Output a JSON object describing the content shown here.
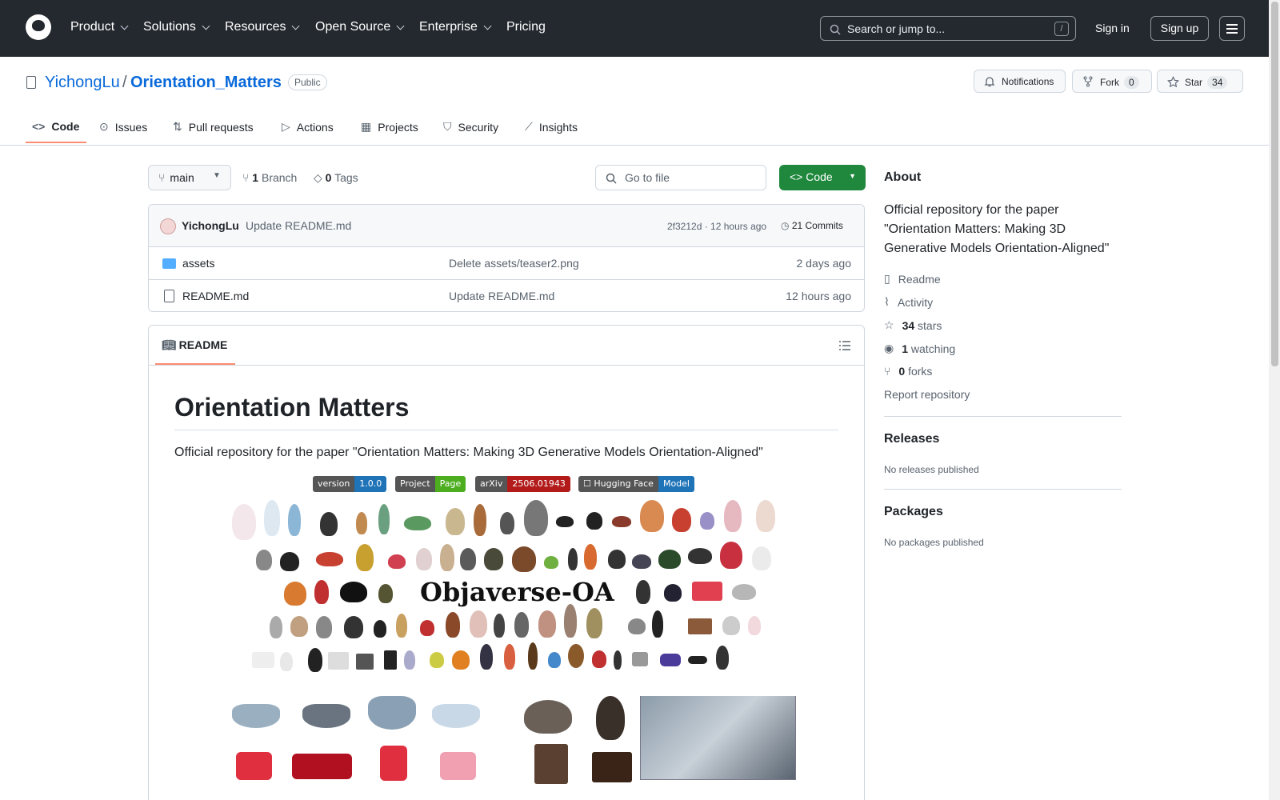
{
  "header": {
    "nav": [
      "Product",
      "Solutions",
      "Resources",
      "Open Source",
      "Enterprise",
      "Pricing"
    ],
    "search_placeholder": "Search or jump to...",
    "search_key": "/",
    "sign_in": "Sign in",
    "sign_up": "Sign up"
  },
  "repo": {
    "owner": "YichongLu",
    "separator": "/",
    "name": "Orientation_Matters",
    "visibility": "Public",
    "notifications": "Notifications",
    "fork_label": "Fork",
    "fork_count": "0",
    "star_label": "Star",
    "star_count": "34"
  },
  "tabs": [
    "Code",
    "Issues",
    "Pull requests",
    "Actions",
    "Projects",
    "Security",
    "Insights"
  ],
  "branch": {
    "name": "main",
    "branch_count": "1",
    "branch_label": "Branch",
    "tag_count": "0",
    "tag_label": "Tags",
    "goto_placeholder": "Go to file",
    "code_button": "Code"
  },
  "commit": {
    "author": "YichongLu",
    "message": "Update README.md",
    "hash_time": "2f3212d · 12 hours ago",
    "commits": "21 Commits"
  },
  "files": [
    {
      "name": "assets",
      "type": "folder",
      "message": "Delete assets/teaser2.png",
      "time": "2 days ago"
    },
    {
      "name": "README.md",
      "type": "file",
      "message": "Update README.md",
      "time": "12 hours ago"
    }
  ],
  "readme": {
    "tab": "README",
    "title": "Orientation Matters",
    "description": "Official repository for the paper \"Orientation Matters: Making 3D Generative Models Orientation-Aligned\"",
    "badges": [
      {
        "left": "version",
        "right": "1.0.0",
        "color": "#1f73b7"
      },
      {
        "left": "Project",
        "right": "Page",
        "color": "#4cae1f"
      },
      {
        "left": "arXiv",
        "right": "2506.01943",
        "color": "#b31b1b"
      },
      {
        "left": "☐ Hugging Face",
        "right": "Model",
        "color": "#1f73b7"
      }
    ],
    "figure_text": "Objaverse-OA"
  },
  "about": {
    "heading": "About",
    "description": "Official repository for the paper \"Orientation Matters: Making 3D Generative Models Orientation-Aligned\"",
    "readme": "Readme",
    "activity": "Activity",
    "stars_count": "34",
    "stars_label": "stars",
    "watching_count": "1",
    "watching_label": "watching",
    "forks_count": "0",
    "forks_label": "forks",
    "report": "Report repository"
  },
  "releases": {
    "heading": "Releases",
    "text": "No releases published"
  },
  "packages": {
    "heading": "Packages",
    "text": "No packages published"
  },
  "colors": {
    "header_bg": "#24292f",
    "link": "#0969da",
    "green": "#1f883d",
    "tab_underline": "#fd8c73"
  }
}
